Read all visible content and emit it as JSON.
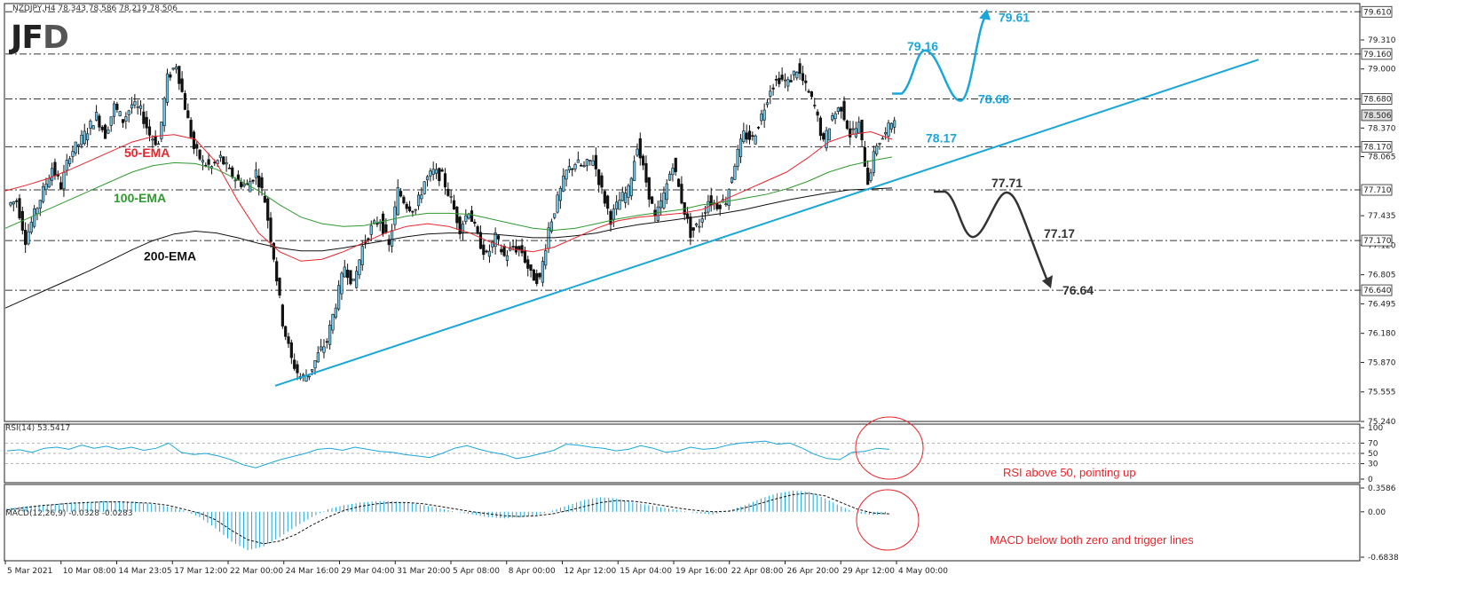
{
  "header": {
    "ticker": "NZDJPY,H4  78.343 78.586 78.219 78.506",
    "logo_j": "JF",
    "logo_d": "D"
  },
  "chart_data": {
    "type": "candlestick",
    "symbol": "NZDJPY",
    "timeframe": "H4",
    "price_axis_ticks": [
      79.31,
      79.0,
      78.37,
      78.065,
      77.435,
      77.12,
      76.805,
      76.495,
      76.18,
      75.87,
      75.555,
      75.24
    ],
    "highlighted_levels": [
      79.61,
      79.16,
      78.68,
      78.506,
      78.17,
      77.71,
      77.17,
      76.64
    ],
    "highlighted_level_labels": [
      "79.610",
      "79.160",
      "78.680",
      "78.506",
      "78.170",
      "77.710",
      "77.170",
      "76.640"
    ],
    "ylim": [
      75.24,
      79.66
    ],
    "x_tick_labels": [
      "5 Mar 2021",
      "10 Mar 08:00",
      "14 Mar 23:05",
      "17 Mar 12:00",
      "22 Mar 00:00",
      "24 Mar 16:00",
      "29 Mar 04:00",
      "31 Mar 20:00",
      "5 Apr 08:00",
      "8 Apr 00:00",
      "12 Apr 12:00",
      "15 Apr 04:00",
      "19 Apr 16:00",
      "22 Apr 08:00",
      "26 Apr 20:00",
      "29 Apr 12:00",
      "4 May 00:00"
    ],
    "price_path": [
      77.55,
      77.6,
      77.18,
      77.45,
      77.7,
      77.95,
      77.75,
      78.1,
      78.2,
      78.35,
      78.5,
      78.3,
      78.6,
      78.45,
      78.62,
      78.55,
      78.3,
      78.2,
      78.9,
      79.05,
      78.6,
      78.15,
      78.0,
      77.95,
      78.05,
      77.9,
      77.8,
      77.75,
      77.9,
      77.6,
      77.0,
      76.3,
      75.9,
      75.7,
      75.75,
      75.95,
      76.1,
      76.5,
      76.9,
      76.7,
      77.1,
      77.3,
      77.4,
      77.1,
      77.7,
      77.55,
      77.5,
      77.8,
      77.9,
      77.85,
      77.6,
      77.3,
      77.5,
      77.2,
      77.0,
      77.2,
      77.0,
      77.1,
      77.05,
      76.8,
      76.75,
      77.3,
      77.6,
      77.9,
      78.0,
      77.95,
      78.05,
      77.7,
      77.4,
      77.6,
      77.7,
      78.2,
      77.8,
      77.4,
      77.65,
      78.0,
      77.6,
      77.25,
      77.35,
      77.6,
      77.55,
      77.6,
      78.0,
      78.3,
      78.25,
      78.5,
      78.8,
      78.9,
      78.85,
      79.0,
      78.8,
      78.6,
      78.2,
      78.5,
      78.6,
      78.3,
      78.4,
      77.8,
      78.2,
      78.3,
      78.506
    ],
    "ema50": [
      77.7,
      77.76,
      77.83,
      77.92,
      78.02,
      78.12,
      78.22,
      78.28,
      78.3,
      78.25,
      78.0,
      77.6,
      77.25,
      77.05,
      76.95,
      76.97,
      77.05,
      77.15,
      77.25,
      77.32,
      77.35,
      77.32,
      77.25,
      77.15,
      77.08,
      77.05,
      77.1,
      77.2,
      77.3,
      77.38,
      77.42,
      77.44,
      77.46,
      77.5,
      77.6,
      77.7,
      77.8,
      77.9,
      78.05,
      78.22,
      78.3,
      78.33,
      78.25
    ],
    "ema100": [
      77.3,
      77.4,
      77.5,
      77.6,
      77.7,
      77.8,
      77.9,
      77.97,
      78.0,
      77.99,
      77.93,
      77.82,
      77.7,
      77.55,
      77.42,
      77.35,
      77.32,
      77.33,
      77.38,
      77.43,
      77.46,
      77.46,
      77.45,
      77.4,
      77.35,
      77.3,
      77.28,
      77.3,
      77.35,
      77.4,
      77.44,
      77.47,
      77.5,
      77.55,
      77.58,
      77.62,
      77.66,
      77.72,
      77.8,
      77.9,
      77.97,
      78.02,
      78.06
    ],
    "ema200": [
      76.45,
      76.55,
      76.65,
      76.75,
      76.85,
      76.96,
      77.07,
      77.17,
      77.24,
      77.27,
      77.25,
      77.2,
      77.14,
      77.09,
      77.06,
      77.06,
      77.09,
      77.13,
      77.17,
      77.21,
      77.24,
      77.25,
      77.25,
      77.24,
      77.22,
      77.2,
      77.2,
      77.22,
      77.25,
      77.3,
      77.34,
      77.37,
      77.4,
      77.43,
      77.46,
      77.5,
      77.55,
      77.6,
      77.64,
      77.68,
      77.71,
      77.72,
      77.73
    ],
    "ema_labels": [
      {
        "text": "50-EMA",
        "color": "#e8242a"
      },
      {
        "text": "100-EMA",
        "color": "#2e9a2e"
      },
      {
        "text": "200-EMA",
        "color": "#111111"
      }
    ],
    "trendline": {
      "from": {
        "date": "24 Mar 16:00",
        "price": 75.62
      },
      "to_price_at_chart_end": 79.1,
      "color": "#1aa6d8"
    },
    "bull_scenario": {
      "labels": [
        "79.16",
        "78.68",
        "79.61"
      ],
      "color": "#1aa6d8"
    },
    "bear_scenario": {
      "labels": [
        "77.71",
        "77.17",
        "76.64"
      ],
      "color": "#333333"
    },
    "level_annotation": "78.17",
    "level_annotation_color": "#1aa6d8",
    "rsi": {
      "title": "RSI(14) 53.5417",
      "ticks": [
        100,
        70,
        50,
        30,
        0
      ],
      "levels": [
        70,
        50,
        30
      ],
      "values": [
        55,
        57,
        52,
        60,
        62,
        58,
        66,
        60,
        64,
        58,
        62,
        56,
        60,
        70,
        52,
        48,
        50,
        45,
        38,
        28,
        22,
        30,
        38,
        44,
        50,
        58,
        60,
        56,
        62,
        58,
        54,
        52,
        48,
        45,
        42,
        50,
        60,
        65,
        58,
        52,
        48,
        40,
        44,
        50,
        56,
        68,
        66,
        62,
        60,
        55,
        58,
        65,
        60,
        52,
        55,
        62,
        58,
        60,
        66,
        70,
        72,
        74,
        68,
        70,
        60,
        48,
        40,
        38,
        52,
        54,
        60,
        58
      ],
      "color": "#1aa6d8",
      "circle_label": "RSI above 50, pointing up"
    },
    "macd": {
      "title": "MACD(12,26,9) -0.0328 -0.0283",
      "ticks": [
        "0.3586",
        "0.00",
        "-0.6838"
      ],
      "ylim": [
        -0.6838,
        0.3586
      ],
      "histogram": [
        0.05,
        0.08,
        0.1,
        0.12,
        0.14,
        0.15,
        0.16,
        0.16,
        0.15,
        0.12,
        0.08,
        0.02,
        -0.08,
        -0.25,
        -0.45,
        -0.58,
        -0.52,
        -0.38,
        -0.22,
        -0.08,
        0.04,
        0.1,
        0.14,
        0.16,
        0.16,
        0.14,
        0.1,
        0.05,
        0.0,
        -0.04,
        -0.08,
        -0.1,
        -0.08,
        -0.05,
        0.02,
        0.1,
        0.18,
        0.22,
        0.2,
        0.14,
        0.1,
        0.06,
        0.02,
        -0.02,
        -0.04,
        0.02,
        0.1,
        0.2,
        0.28,
        0.32,
        0.3,
        0.2,
        0.08,
        -0.02,
        -0.05,
        -0.03
      ],
      "signal": [
        0.03,
        0.06,
        0.09,
        0.11,
        0.13,
        0.14,
        0.15,
        0.15,
        0.14,
        0.13,
        0.1,
        0.04,
        -0.02,
        -0.12,
        -0.28,
        -0.42,
        -0.48,
        -0.44,
        -0.34,
        -0.2,
        -0.08,
        0.02,
        0.08,
        0.12,
        0.14,
        0.14,
        0.12,
        0.08,
        0.04,
        0.0,
        -0.03,
        -0.06,
        -0.07,
        -0.06,
        -0.03,
        0.02,
        0.08,
        0.14,
        0.17,
        0.16,
        0.13,
        0.09,
        0.05,
        0.02,
        0.0,
        0.01,
        0.06,
        0.13,
        0.2,
        0.26,
        0.28,
        0.24,
        0.14,
        0.04,
        -0.02,
        -0.03
      ],
      "hist_color": "#1aa6d8",
      "signal_color": "#111111",
      "circle_label": "MACD below both zero and trigger lines"
    }
  },
  "annotation_color": "#e8242a"
}
